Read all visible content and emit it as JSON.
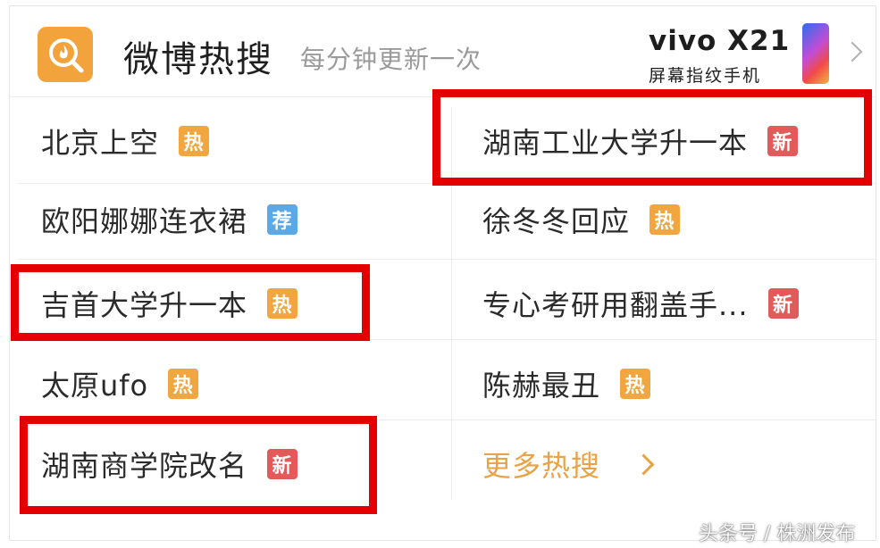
{
  "header": {
    "title": "微博热搜",
    "subtitle": "每分钟更新一次",
    "ad": {
      "brand": "vivo X21",
      "tagline": "屏幕指纹手机"
    }
  },
  "colors": {
    "hot": "#f2a640",
    "new": "#e25a5a",
    "recommend": "#5aa8e6",
    "highlight": "#e40000",
    "more": "#e9a245"
  },
  "left_items": [
    {
      "label": "北京上空",
      "badge": "热",
      "badge_type": "hot"
    },
    {
      "label": "欧阳娜娜连衣裙",
      "badge": "荐",
      "badge_type": "recommend"
    },
    {
      "label": "吉首大学升一本",
      "badge": "热",
      "badge_type": "hot"
    },
    {
      "label": "太原ufo",
      "badge": "热",
      "badge_type": "hot"
    },
    {
      "label": "湖南商学院改名",
      "badge": "新",
      "badge_type": "new"
    }
  ],
  "right_items": [
    {
      "label": "湖南工业大学升一本",
      "badge": "新",
      "badge_type": "new"
    },
    {
      "label": "徐冬冬回应",
      "badge": "热",
      "badge_type": "hot"
    },
    {
      "label": "专心考研用翻盖手...",
      "badge": "新",
      "badge_type": "new"
    },
    {
      "label": "陈赫最丑",
      "badge": "热",
      "badge_type": "hot"
    }
  ],
  "more": {
    "label": "更多热搜"
  },
  "watermark": "头条号 / 株洲发布"
}
